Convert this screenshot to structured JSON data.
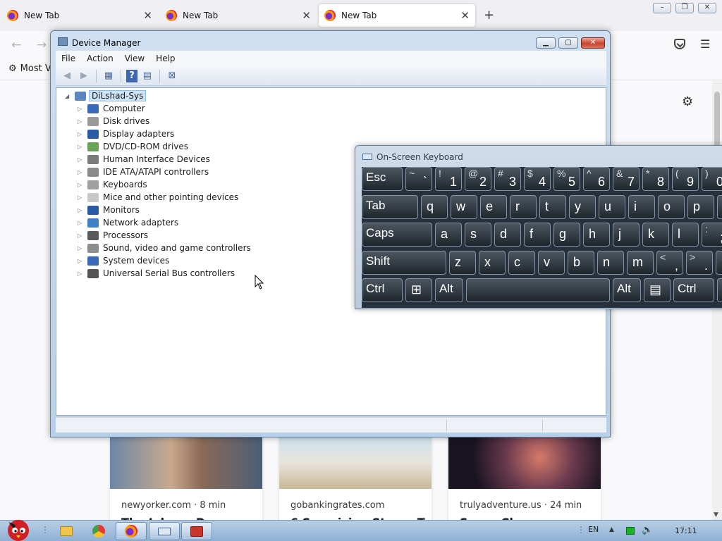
{
  "browser": {
    "tabs": [
      {
        "label": "New Tab",
        "active": false
      },
      {
        "label": "New Tab",
        "active": false
      },
      {
        "label": "New Tab",
        "active": true
      }
    ],
    "new_tab": "+",
    "window_buttons": {
      "minimize": "–",
      "restore": "❐",
      "close": "✕"
    },
    "bookmark_toolbar": {
      "most_visited": "Most Vi"
    }
  },
  "cards": [
    {
      "source": "newyorker.com · 8 min",
      "headline": "The Johnny D"
    },
    {
      "source": "gobankingrates.com",
      "headline": "6 Surprising Stores T"
    },
    {
      "source": "trulyadventure.us · 24 min",
      "headline": "Sugar Cha"
    }
  ],
  "device_manager": {
    "title": "Device Manager",
    "menu": [
      "File",
      "Action",
      "View",
      "Help"
    ],
    "root": "DiLshad-Sys",
    "devices": [
      {
        "label": "Computer",
        "icon": "computer-icon",
        "color": "#3b68b8"
      },
      {
        "label": "Disk drives",
        "icon": "disk-drive-icon",
        "color": "#9a9a9a"
      },
      {
        "label": "Display adapters",
        "icon": "display-adapter-icon",
        "color": "#2d5aa6"
      },
      {
        "label": "DVD/CD-ROM drives",
        "icon": "dvd-drive-icon",
        "color": "#6aa25a"
      },
      {
        "label": "Human Interface Devices",
        "icon": "hid-icon",
        "color": "#7a7a7a"
      },
      {
        "label": "IDE ATA/ATAPI controllers",
        "icon": "ide-controller-icon",
        "color": "#8a8a8a"
      },
      {
        "label": "Keyboards",
        "icon": "keyboard-icon",
        "color": "#a0a0a0"
      },
      {
        "label": "Mice and other pointing devices",
        "icon": "mouse-icon",
        "color": "#c8c8c8"
      },
      {
        "label": "Monitors",
        "icon": "monitor-icon",
        "color": "#2d5aa6"
      },
      {
        "label": "Network adapters",
        "icon": "network-adapter-icon",
        "color": "#3f7fc4"
      },
      {
        "label": "Processors",
        "icon": "processor-icon",
        "color": "#5a5a5a"
      },
      {
        "label": "Sound, video and game controllers",
        "icon": "speaker-icon",
        "color": "#8d8d8d"
      },
      {
        "label": "System devices",
        "icon": "system-devices-icon",
        "color": "#3b68b8"
      },
      {
        "label": "Universal Serial Bus controllers",
        "icon": "usb-icon",
        "color": "#555555"
      }
    ]
  },
  "osk": {
    "title": "On-Screen Keyboard",
    "rows": [
      [
        {
          "t": "Esc"
        },
        {
          "u": "~",
          "l": "`"
        },
        {
          "u": "!",
          "l": "1"
        },
        {
          "u": "@",
          "l": "2"
        },
        {
          "u": "#",
          "l": "3"
        },
        {
          "u": "$",
          "l": "4"
        },
        {
          "u": "%",
          "l": "5"
        },
        {
          "u": "^",
          "l": "6"
        },
        {
          "u": "&",
          "l": "7"
        },
        {
          "u": "*",
          "l": "8"
        },
        {
          "u": "(",
          "l": "9"
        },
        {
          "u": ")",
          "l": "0"
        }
      ],
      [
        {
          "t": "Tab"
        },
        {
          "m": "q"
        },
        {
          "m": "w"
        },
        {
          "m": "e"
        },
        {
          "m": "r"
        },
        {
          "m": "t"
        },
        {
          "m": "y"
        },
        {
          "m": "u"
        },
        {
          "m": "i"
        },
        {
          "m": "o"
        },
        {
          "m": "p"
        },
        {
          "m": "["
        }
      ],
      [
        {
          "t": "Caps"
        },
        {
          "m": "a"
        },
        {
          "m": "s"
        },
        {
          "m": "d"
        },
        {
          "m": "f"
        },
        {
          "m": "g"
        },
        {
          "m": "h"
        },
        {
          "m": "j"
        },
        {
          "m": "k"
        },
        {
          "m": "l"
        },
        {
          "u": ":",
          "l": ";"
        }
      ],
      [
        {
          "t": "Shift"
        },
        {
          "m": "z"
        },
        {
          "m": "x"
        },
        {
          "m": "c"
        },
        {
          "m": "v"
        },
        {
          "m": "b"
        },
        {
          "m": "n"
        },
        {
          "m": "m"
        },
        {
          "u": "<",
          "l": ","
        },
        {
          "u": ">",
          "l": "."
        },
        {
          "m": "?"
        }
      ],
      [
        {
          "t": "Ctrl"
        },
        {
          "m": "⊞",
          "name": "windows-logo-icon"
        },
        {
          "t": "Alt"
        },
        {
          "t": ""
        },
        {
          "t": "Alt"
        },
        {
          "m": "▤",
          "name": "menu-key-icon"
        },
        {
          "t": "Ctrl"
        },
        {
          "m": ""
        }
      ]
    ]
  },
  "taskbar": {
    "lang": "EN",
    "clock": "17:11"
  }
}
